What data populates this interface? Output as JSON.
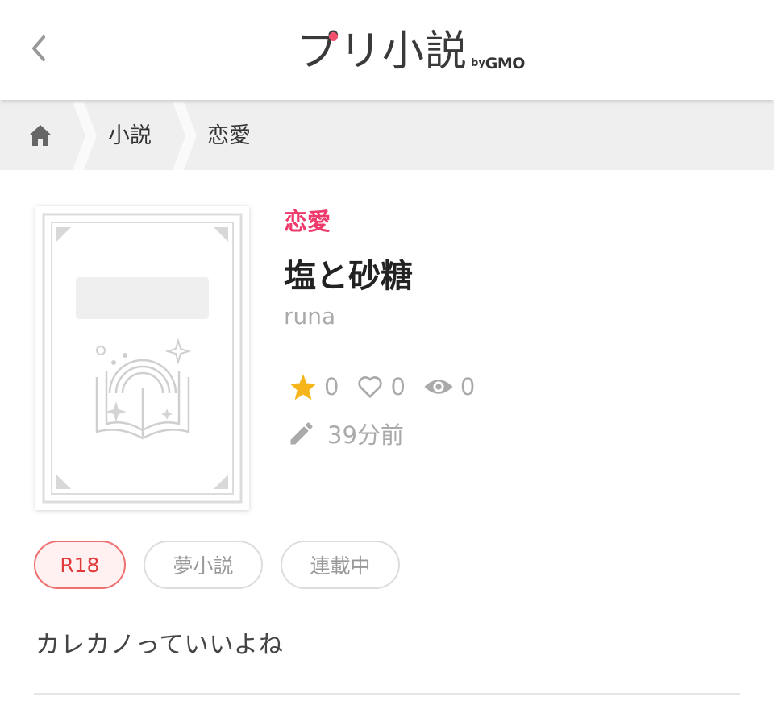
{
  "header": {
    "logo_main": "プリ小説",
    "logo_by": "by",
    "logo_gmo": "GMO"
  },
  "breadcrumb": {
    "items": [
      {
        "label": "小説"
      },
      {
        "label": "恋愛"
      }
    ]
  },
  "novel": {
    "genre": "恋愛",
    "title": "塩と砂糖",
    "author": "runa",
    "favorites": "0",
    "likes": "0",
    "views": "0",
    "updated": "39分前",
    "summary": "カレカノっていいよね"
  },
  "tags": [
    {
      "label": "R18"
    },
    {
      "label": "夢小説"
    },
    {
      "label": "連載中"
    }
  ],
  "colors": {
    "accent": "#ef3a6c",
    "star": "#f5b51b",
    "r18_border": "#f07070",
    "r18_text": "#e03a3a",
    "muted": "#aaaaaa",
    "breadcrumb_bg": "#efefef"
  },
  "icons": {
    "back": "chevron-left-icon",
    "home": "home-icon",
    "favorite": "star-icon",
    "like": "heart-icon",
    "view": "eye-icon",
    "update": "pencil-icon"
  }
}
